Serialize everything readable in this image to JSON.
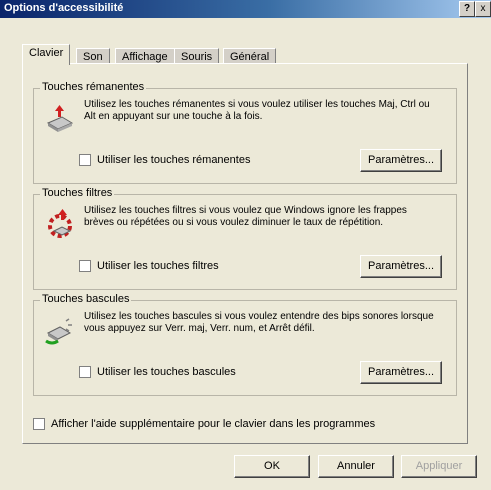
{
  "window": {
    "title": "Options d'accessibilité",
    "help_label": "?",
    "close_label": "x"
  },
  "tabs": [
    {
      "label": "Clavier",
      "active": true
    },
    {
      "label": "Son",
      "active": false
    },
    {
      "label": "Affichage",
      "active": false
    },
    {
      "label": "Souris",
      "active": false
    },
    {
      "label": "Général",
      "active": false
    }
  ],
  "groups": {
    "sticky": {
      "title": "Touches rémanentes",
      "icon": "sticky-keys-icon",
      "desc": "Utilisez les touches rémanentes si vous voulez utiliser les touches Maj, Ctrl ou Alt en appuyant sur une touche à la fois.",
      "checkbox": "Utiliser les touches rémanentes",
      "settings": "Paramètres..."
    },
    "filter": {
      "title": "Touches filtres",
      "icon": "filter-keys-icon",
      "desc": "Utilisez les touches filtres si vous voulez que Windows ignore les frappes brèves ou répétées ou si vous voulez diminuer le taux de répétition.",
      "checkbox": "Utiliser les touches filtres",
      "settings": "Paramètres..."
    },
    "toggle": {
      "title": "Touches bascules",
      "icon": "toggle-keys-icon",
      "desc": "Utilisez les touches bascules si vous voulez entendre des bips sonores lorsque vous appuyez sur Verr. maj, Verr. num, et Arrêt défil.",
      "checkbox": "Utiliser les touches bascules",
      "settings": "Paramètres..."
    }
  },
  "extra_checkbox": "Afficher l'aide supplémentaire pour le clavier dans les programmes",
  "buttons": {
    "ok": "OK",
    "cancel": "Annuler",
    "apply": "Appliquer"
  }
}
